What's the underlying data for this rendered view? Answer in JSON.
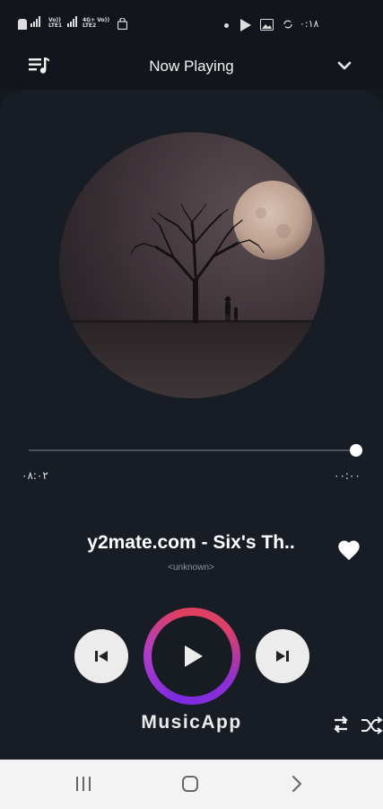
{
  "status_bar": {
    "network_1": "Vo)) LTE1",
    "network_2": "4G+ Vo)) LTE2",
    "clock": "٠:١٨"
  },
  "header": {
    "title": "Now Playing",
    "playlist_icon": "playlist-icon",
    "collapse_icon": "chevron-down-icon"
  },
  "player": {
    "elapsed": "٠٨:٠٢",
    "duration": "٠٠:٠٠",
    "progress": 1.0,
    "song_title": "y2mate.com - Six's Th..",
    "artist": "<unknown>",
    "favorite": true
  },
  "controls": {
    "previous_icon": "skip-previous-icon",
    "play_icon": "play-icon",
    "next_icon": "skip-next-icon",
    "repeat_icon": "repeat-icon",
    "shuffle_icon": "shuffle-icon"
  },
  "brand": "MusicApp",
  "nav_bar": {
    "recents_icon": "recents-icon",
    "home_icon": "home-icon",
    "back_icon": "back-icon"
  },
  "colors": {
    "background": "#14181f",
    "panel": "#181c24",
    "ring_start": "#7b2be0",
    "ring_end": "#e0405c"
  }
}
